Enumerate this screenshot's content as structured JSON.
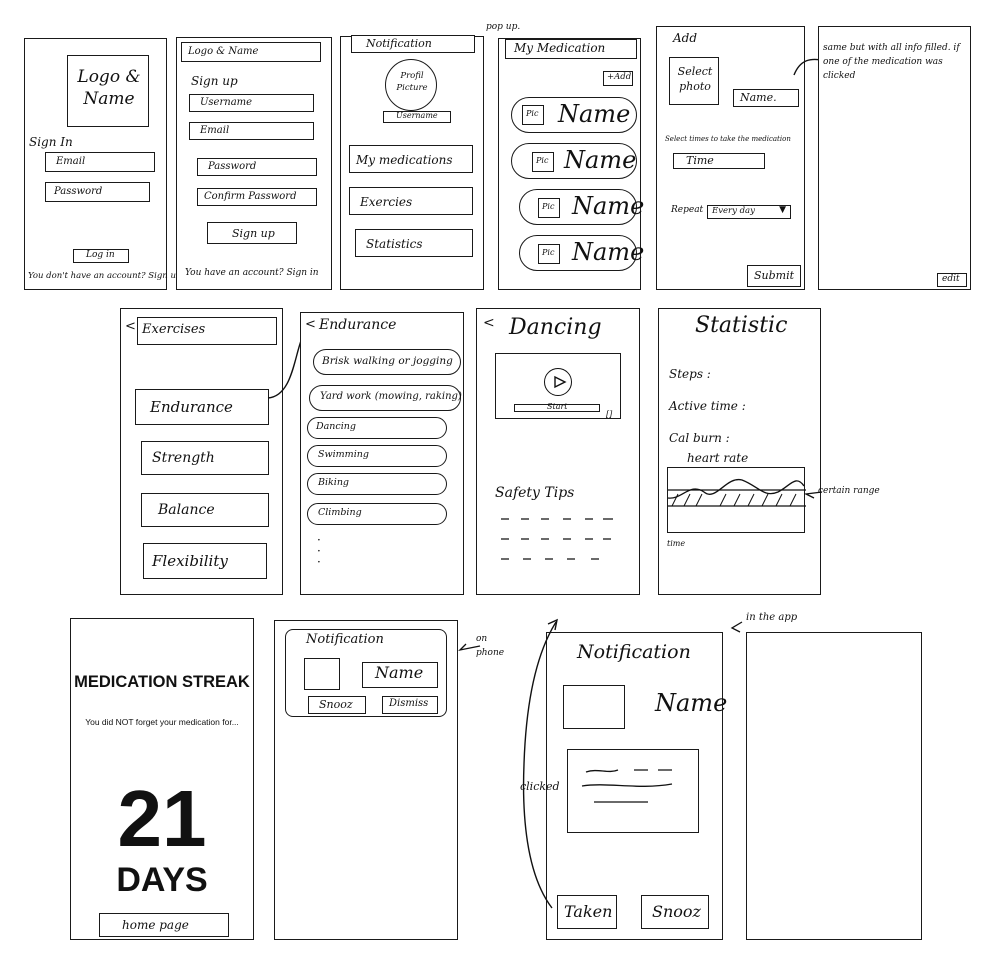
{
  "login": {
    "logo": "Logo & Name",
    "signin": "Sign In",
    "email": "Email",
    "password": "Password",
    "login_btn": "Log in",
    "no_account": "You don't have an account? Sign up"
  },
  "signup": {
    "logo": "Logo & Name",
    "signup_title": "Sign up",
    "username": "Username",
    "email": "Email",
    "password": "Password",
    "confirm": "Confirm Password",
    "signup_btn": "Sign up",
    "have_account": "You have an account? Sign in"
  },
  "menu": {
    "notification": "Notification",
    "popup_note": "pop up.",
    "profile": "Profil Picture",
    "username": "Username",
    "items": [
      "My medications",
      "Exercies",
      "Statistics"
    ]
  },
  "medication": {
    "title": "My Medication",
    "add": "+Add",
    "pic": "Pic",
    "name": "Name"
  },
  "add": {
    "title": "Add",
    "select_photo": "Select photo",
    "name": "Name.",
    "time_label": "Select times to take the medication",
    "time": "Time",
    "repeat_label": "Repeat",
    "repeat_value": "Every day",
    "submit": "Submit"
  },
  "edit": {
    "note": "same but with all info filled. if one of the medication was clicked",
    "edit_btn": "edit"
  },
  "exercises": {
    "back": "<",
    "title": "Exercises",
    "items": [
      "Endurance",
      "Strength",
      "Balance",
      "Flexibility"
    ]
  },
  "endurance": {
    "back": "<",
    "title": "Endurance",
    "items": [
      "Brisk walking or jogging",
      "Yard work (mowing, raking)",
      "Dancing",
      "Swimming",
      "Biking",
      "Climbing"
    ]
  },
  "dancing": {
    "back": "<",
    "title": "Dancing",
    "video_label": "Start",
    "fullscreen": "[]",
    "safety": "Safety Tips"
  },
  "statistic": {
    "title": "Statistic",
    "steps": "Steps :",
    "active": "Active time :",
    "cal": "Cal burn :",
    "heart": "heart rate",
    "time_axis": "time",
    "range_note": "certain range"
  },
  "streak": {
    "title": "MEDICATION STREAK",
    "subtitle": "You did NOT forget your medication for...",
    "number": "21",
    "days": "DAYS",
    "home": "home page"
  },
  "phone_notif": {
    "title": "Notification",
    "name": "Name",
    "snooze": "Snooz",
    "dismiss": "Dismiss",
    "note": "on phone"
  },
  "app_notif": {
    "title": "Notification",
    "name": "Name",
    "taken": "Taken",
    "snooze": "Snooz",
    "clicked": "clicked",
    "in_app": "in the app"
  }
}
